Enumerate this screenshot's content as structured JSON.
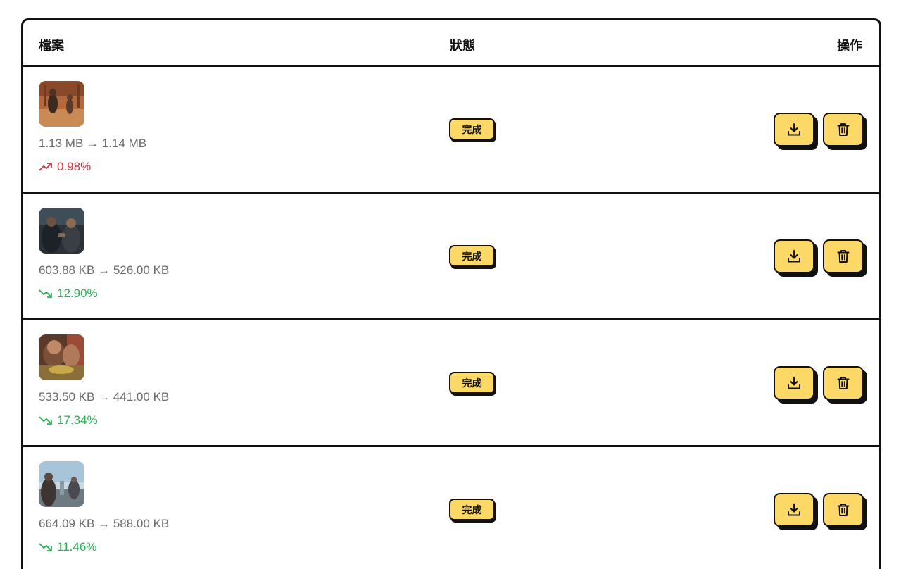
{
  "table": {
    "headers": {
      "file": "檔案",
      "status": "狀態",
      "actions": "操作"
    },
    "rows": [
      {
        "thumbnail": "image-thumbnail",
        "sizes": "1.13 MB → 1.14 MB",
        "delta": "0.98%",
        "trend": "up",
        "status": "完成",
        "download_icon": "download-icon",
        "delete_icon": "trash-icon"
      },
      {
        "thumbnail": "image-thumbnail",
        "sizes": "603.88 KB → 526.00 KB",
        "delta": "12.90%",
        "trend": "down",
        "status": "完成",
        "download_icon": "download-icon",
        "delete_icon": "trash-icon"
      },
      {
        "thumbnail": "image-thumbnail",
        "sizes": "533.50 KB → 441.00 KB",
        "delta": "17.34%",
        "trend": "down",
        "status": "完成",
        "download_icon": "download-icon",
        "delete_icon": "trash-icon"
      },
      {
        "thumbnail": "image-thumbnail",
        "sizes": "664.09 KB → 588.00 KB",
        "delta": "11.46%",
        "trend": "down",
        "status": "完成",
        "download_icon": "download-icon",
        "delete_icon": "trash-icon"
      }
    ]
  },
  "colors": {
    "accent": "#fcd867",
    "increase": "#d5333e",
    "decrease": "#22b451",
    "border": "#111111"
  }
}
